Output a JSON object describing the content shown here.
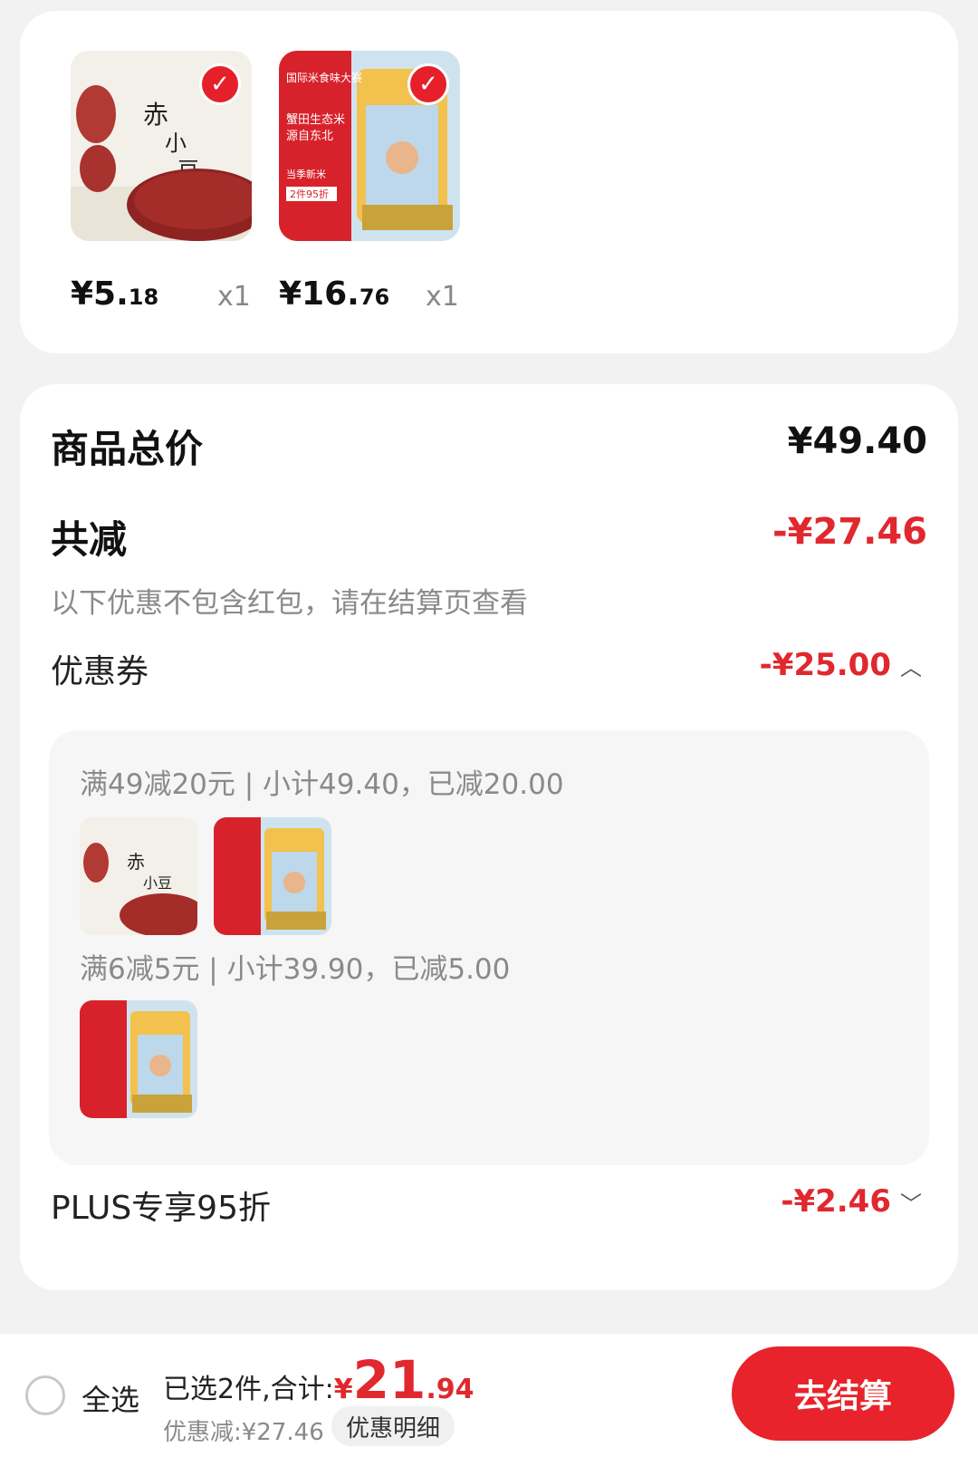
{
  "cart_items": [
    {
      "name": "赤小豆",
      "price_int": "¥5.",
      "price_dec": "18",
      "qty": "x1",
      "selected": true,
      "icon": "adzuki-bean-product-image"
    },
    {
      "name": "蟹田生态米",
      "price_int": "¥16.",
      "price_dec": "76",
      "qty": "x1",
      "selected": true,
      "icon": "rice-product-image"
    }
  ],
  "summary": {
    "total_label": "商品总价",
    "total_value": "¥49.40",
    "reduce_label": "共减",
    "reduce_value": "-¥27.46",
    "note": "以下优惠不包含红包，请在结算页查看",
    "coupon_label": "优惠券",
    "coupon_value": "-¥25.00",
    "coupon_rules": [
      {
        "text": "满49减20元 | 小计49.40，已减20.00"
      },
      {
        "text": "满6减5元 | 小计39.90，已减5.00"
      }
    ],
    "plus_label": "PLUS专享95折",
    "plus_value": "-¥2.46"
  },
  "bottom_bar": {
    "select_all": "全选",
    "selected_text": "已选2件,合计:",
    "total_cur": "¥",
    "total_int": "21",
    "total_dec": ".94",
    "discount_text": "优惠减:¥27.46",
    "detail_button": "优惠明细",
    "checkout_button": "去结算"
  },
  "colors": {
    "accent": "#e0282e",
    "checkout": "#e8232b"
  }
}
